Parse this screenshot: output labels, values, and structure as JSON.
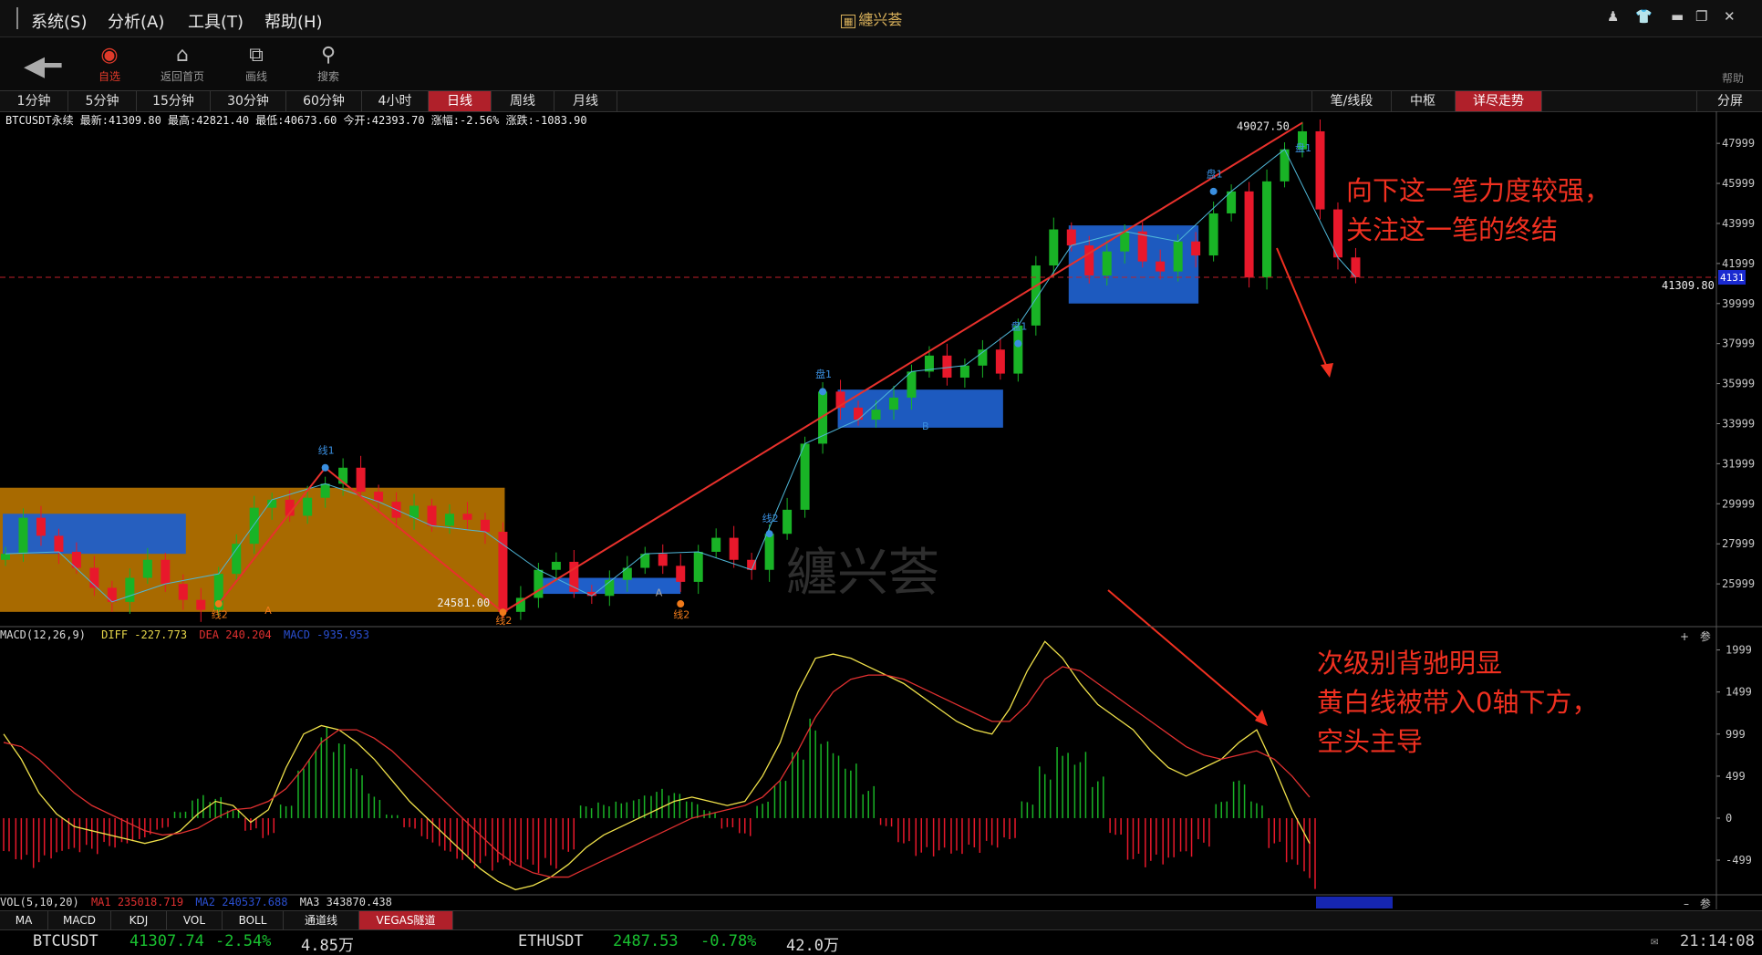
{
  "menu": {
    "items": [
      "系统(S)",
      "分析(A)",
      "工具(T)",
      "帮助(H)"
    ]
  },
  "app_title": "纏兴荟",
  "toolbar": {
    "back_icon": "left-arrow-icon",
    "items": [
      {
        "label": "自选",
        "icon": "favorites-icon",
        "active": true
      },
      {
        "label": "返回首页",
        "icon": "home-icon"
      },
      {
        "label": "画线",
        "icon": "draw-line-icon"
      },
      {
        "label": "搜索",
        "icon": "search-icon"
      }
    ],
    "help": "帮助"
  },
  "periods": [
    "1分钟",
    "5分钟",
    "15分钟",
    "30分钟",
    "60分钟",
    "4小时",
    "日线",
    "周线",
    "月线"
  ],
  "active_period": "日线",
  "right_tabs": [
    "笔/线段",
    "中枢",
    "详尽走势"
  ],
  "split_label": "分屏",
  "info_line": "BTCUSDT永续  最新:41309.80 最高:42821.40 最低:40673.60 今开:42393.70 涨幅:-2.56% 涨跌:-1083.90",
  "chart_labels": {
    "high_value": "49027.50",
    "low_value": "24581.00",
    "last_price": "41309.80",
    "last_tag": "4131",
    "watermark": "纏兴荟",
    "markers": [
      "线1",
      "线2",
      "线2",
      "线2",
      "线2",
      "盘1",
      "盘1",
      "盘1",
      "盘1",
      "A",
      "A",
      "B"
    ]
  },
  "annotations": {
    "top": [
      "向下这一笔力度较强，",
      "关注这一笔的终结"
    ],
    "bottom": [
      "次级别背驰明显",
      "黄白线被带入0轴下方，",
      "空头主导"
    ]
  },
  "macd_info": {
    "name": "MACD(12,26,9)",
    "diff": "DIFF -227.773",
    "dea": "DEA 240.204",
    "macd": "MACD -935.953"
  },
  "vol_info": {
    "name": "VOL(5,10,20)",
    "ma1": "MA1 235018.719",
    "ma2": "MA2 240537.688",
    "ma3": "MA3 343870.438"
  },
  "indicator_tabs": [
    "MA",
    "MACD",
    "KDJ",
    "VOL",
    "BOLL",
    "通道线",
    "VEGAS隧道"
  ],
  "active_indicator": "VEGAS隧道",
  "pane_controls": {
    "plus": "+",
    "minus": "–",
    "param": "参"
  },
  "ticker": [
    {
      "symbol": "BTCUSDT",
      "price": "41307.74",
      "change": "-2.54%",
      "volume": "4.85万"
    },
    {
      "symbol": "ETHUSDT",
      "price": "2487.53",
      "change": "-0.78%",
      "volume": "42.0万"
    }
  ],
  "clock": "21:14:08",
  "chart_data": [
    {
      "type": "candlestick",
      "symbol": "BTCUSDT永续",
      "period": "日线",
      "y_ticks": [
        25999,
        27999,
        29999,
        31999,
        33999,
        35999,
        37999,
        39999,
        41999,
        43999,
        45999,
        47999
      ],
      "ylim": [
        24000,
        49600
      ],
      "last": 41309.8,
      "high": 42821.4,
      "low": 40673.6,
      "open": 42393.7,
      "change_pct": -2.56,
      "change": -1083.9,
      "period_high": 49027.5,
      "period_low": 24581.0,
      "close_path": [
        27500,
        29300,
        28400,
        27600,
        26800,
        25800,
        25100,
        26300,
        27200,
        26000,
        25200,
        24700,
        26500,
        28000,
        29800,
        30200,
        29400,
        30300,
        31000,
        31800,
        30600,
        30100,
        29300,
        29900,
        28900,
        29500,
        29200,
        28600,
        24600,
        25300,
        26700,
        27100,
        25600,
        25400,
        26200,
        26800,
        27500,
        26900,
        26100,
        27600,
        28300,
        27200,
        26700,
        28500,
        29700,
        33000,
        35600,
        34800,
        34200,
        34700,
        35300,
        36600,
        37400,
        36300,
        36900,
        37700,
        36500,
        38900,
        41900,
        43700,
        42900,
        41400,
        42600,
        43600,
        42100,
        41600,
        43100,
        42400,
        44500,
        45600,
        41300,
        46100,
        47700,
        48600,
        44700,
        42300,
        41310
      ],
      "pivots": [
        [
          0,
          27500,
          29500,
          "盘1"
        ],
        [
          43,
          24600,
          30800,
          ""
        ],
        [
          47,
          33800,
          35700,
          "盘1"
        ],
        [
          60,
          40000,
          43900,
          "盘1"
        ]
      ],
      "strokes": [
        [
          18,
          31800
        ],
        [
          28,
          24581
        ],
        [
          73,
          49027.5
        ]
      ]
    },
    {
      "type": "macd",
      "name": "MACD(12,26,9)",
      "y_ticks": [
        -499,
        0,
        499,
        999,
        1499,
        1999
      ],
      "ylim": [
        -900,
        2200
      ],
      "hist": [
        -400,
        -500,
        -600,
        -550,
        -500,
        -450,
        -350,
        -300,
        -250,
        -150,
        100,
        300,
        250,
        100,
        -150,
        -250,
        200,
        800,
        1100,
        900,
        600,
        300,
        50,
        -150,
        -300,
        -400,
        -500,
        -600,
        -700,
        -750,
        -700,
        -600,
        -400,
        150,
        200,
        250,
        300,
        350,
        300,
        200,
        100,
        -150,
        -250,
        200,
        450,
        800,
        1200,
        1050,
        800,
        400,
        -100,
        -300,
        -450,
        -500,
        -550,
        -450,
        -350,
        -250,
        200,
        650,
        1050,
        900,
        500,
        -200,
        -500,
        -600,
        -650,
        -550,
        -350,
        200,
        450,
        200,
        -400,
        -700,
        -900
      ],
      "diff": [
        1000,
        700,
        300,
        50,
        -100,
        -150,
        -200,
        -250,
        -300,
        -250,
        -150,
        50,
        200,
        150,
        -50,
        100,
        600,
        1000,
        1100,
        1050,
        900,
        700,
        450,
        200,
        0,
        -200,
        -400,
        -600,
        -750,
        -850,
        -800,
        -700,
        -550,
        -350,
        -200,
        -100,
        0,
        100,
        200,
        250,
        200,
        150,
        200,
        500,
        900,
        1500,
        1900,
        1950,
        1900,
        1800,
        1700,
        1600,
        1450,
        1300,
        1150,
        1050,
        1000,
        1300,
        1750,
        2100,
        1900,
        1600,
        1350,
        1200,
        1050,
        800,
        600,
        500,
        600,
        700,
        900,
        1050,
        600,
        100,
        -300
      ],
      "dea": [
        900,
        850,
        700,
        500,
        300,
        150,
        50,
        -50,
        -150,
        -200,
        -180,
        -120,
        0,
        100,
        120,
        200,
        350,
        600,
        900,
        1050,
        1050,
        950,
        800,
        600,
        400,
        200,
        0,
        -200,
        -400,
        -550,
        -650,
        -700,
        -700,
        -600,
        -500,
        -400,
        -300,
        -200,
        -100,
        0,
        50,
        100,
        150,
        250,
        450,
        800,
        1200,
        1500,
        1650,
        1700,
        1700,
        1650,
        1550,
        1450,
        1350,
        1250,
        1150,
        1150,
        1350,
        1650,
        1800,
        1750,
        1600,
        1450,
        1300,
        1150,
        1000,
        850,
        750,
        700,
        750,
        800,
        700,
        500,
        250
      ]
    }
  ],
  "colors": {
    "up": "#19b326",
    "down": "#e8182b",
    "pivot": "#1f5fc9",
    "bigpivot": "#a86a00",
    "stroke": "#e8312c",
    "diff": "#f0e14a",
    "dea": "#e03030",
    "accent": "#b0202a"
  }
}
